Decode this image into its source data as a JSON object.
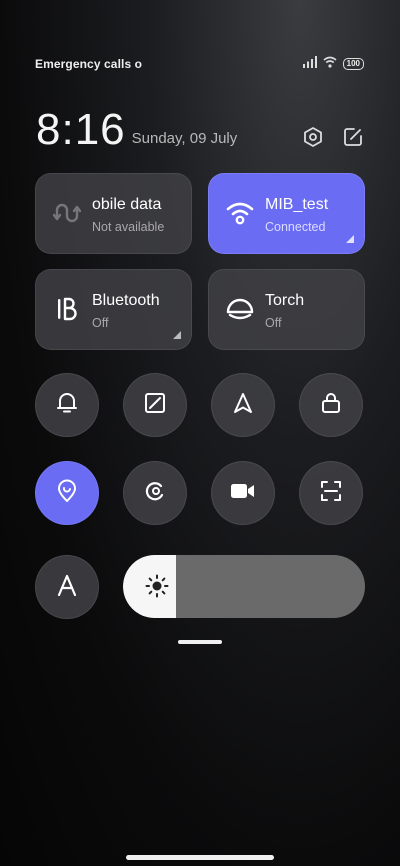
{
  "status_bar": {
    "carrier_text": "Emergency calls o",
    "battery": "100",
    "icons": [
      "signal-icon",
      "wifi-icon",
      "battery-icon"
    ]
  },
  "header": {
    "time": "8:16",
    "date": "Sunday, 09 July",
    "icons": [
      "settings-icon",
      "edit-icon"
    ]
  },
  "tiles": {
    "mobile_data": {
      "title": "obile data",
      "subtitle": "Not available",
      "icon": "mobile-data-icon",
      "active": false
    },
    "wifi": {
      "title": "MIB_test",
      "subtitle": "Connected",
      "icon": "wifi-icon",
      "active": true
    },
    "bluetooth": {
      "title": "Bluetooth",
      "subtitle": "Off",
      "icon": "bluetooth-icon",
      "active": false
    },
    "torch": {
      "title": "Torch",
      "subtitle": "Off",
      "icon": "torch-icon",
      "active": false
    }
  },
  "toggles_row1": [
    "bell-icon",
    "screenshot-icon",
    "location-arrow-icon",
    "lock-icon"
  ],
  "toggles_row2": [
    "location-pin-icon",
    "dark-mode-icon",
    "video-camera-icon",
    "scanner-icon"
  ],
  "auto_brightness_icon": "font-a-icon",
  "brightness": {
    "level_percent": 22,
    "icon": "sun-icon"
  },
  "colors": {
    "accent": "#6a6cf4",
    "tile_bg": "#404044",
    "background": "#0b0b0c"
  }
}
